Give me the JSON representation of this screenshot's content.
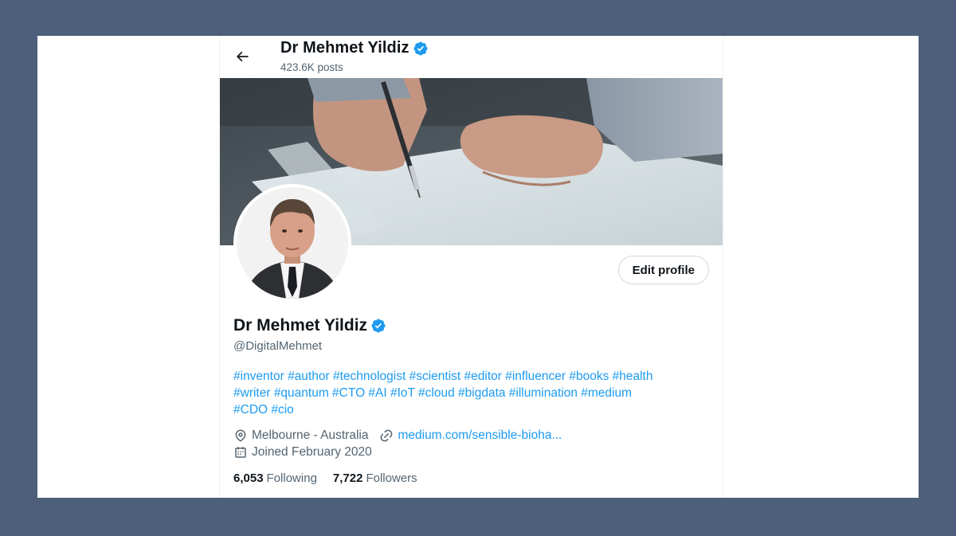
{
  "header": {
    "name": "Dr Mehmet Yildiz",
    "posts": "423.6K posts"
  },
  "profile": {
    "name": "Dr Mehmet Yildiz",
    "handle": "@DigitalMehmet",
    "edit_label": "Edit profile",
    "bio_lines": [
      "#inventor #author #technologist #scientist #editor #influencer #books #health",
      "#writer #quantum #CTO #AI #IoT #cloud #bigdata  #illumination #medium",
      "#CDO #cio"
    ],
    "location": "Melbourne - Australia",
    "website": "medium.com/sensible-bioha...",
    "joined": "Joined February 2020",
    "following_count": "6,053",
    "following_label": "Following",
    "followers_count": "7,722",
    "followers_label": "Followers"
  },
  "colors": {
    "accent": "#1d9bf0",
    "muted": "#536471",
    "text": "#0f1419",
    "backdrop": "#4d5f7a"
  },
  "icons": {
    "back": "arrow-left-icon",
    "verified": "verified-badge-icon",
    "location": "location-pin-icon",
    "link": "link-icon",
    "calendar": "calendar-icon"
  }
}
